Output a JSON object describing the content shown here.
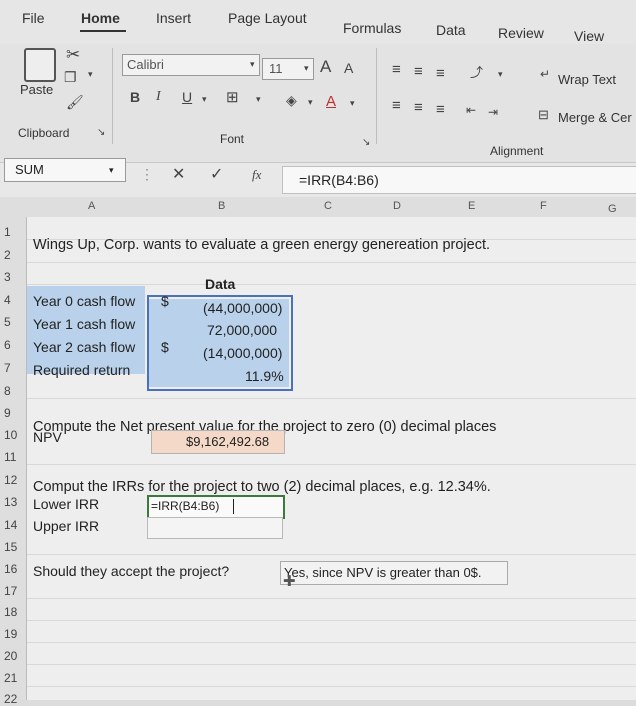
{
  "menu": {
    "file": "File",
    "home": "Home",
    "insert": "Insert",
    "page_layout": "Page Layout",
    "formulas": "Formulas",
    "data": "Data",
    "review": "Review",
    "view": "View"
  },
  "ribbon": {
    "paste": "Paste",
    "clipboard": "Clipboard",
    "font_name": "Calibri",
    "font_size": "11",
    "grow_font": "A",
    "shrink_font": "A",
    "bold": "B",
    "italic": "I",
    "underline": "U",
    "font_color": "A",
    "font_group": "Font",
    "wrap_text": "Wrap Text",
    "merge_center": "Merge & Cer",
    "alignment_group": "Alignment"
  },
  "formula_bar": {
    "name_box": "SUM",
    "cancel": "✕",
    "enter": "✓",
    "fx": "fx",
    "formula": "=IRR(B4:B6)"
  },
  "columns": [
    "A",
    "B",
    "C",
    "D",
    "E",
    "F",
    "G"
  ],
  "rows": [
    "1",
    "2",
    "3",
    "4",
    "5",
    "6",
    "7",
    "8",
    "9",
    "10",
    "11",
    "12",
    "13",
    "14",
    "15",
    "16",
    "17",
    "18",
    "19",
    "20",
    "21",
    "22"
  ],
  "cells": {
    "title": "Wings Up, Corp. wants to evaluate a green energy genereation project.",
    "data_header": "Data",
    "y0_label": "Year 0 cash flow",
    "y0_dollar": "$",
    "y0_value": "(44,000,000)",
    "y1_label": "Year 1 cash flow",
    "y1_value": "72,000,000",
    "y2_label": "Year 2 cash flow",
    "y2_dollar": "$",
    "y2_value": "(14,000,000)",
    "req_label": "Required return",
    "req_value": "11.9%",
    "npv_question": "Compute the Net present value for the project to zero (0) decimal places",
    "npv_label": "NPV",
    "npv_value": "$9,162,492.68",
    "irr_question": "Comput the IRRs for the project to two (2) decimal places, e.g. 12.34%.",
    "lower_irr_label": "Lower IRR",
    "lower_irr_formula": "=IRR(B4:B6)",
    "upper_irr_label": "Upper IRR",
    "accept_question": "Should they accept the project?",
    "accept_answer": "Yes, since NPV is greater than 0$."
  },
  "colors": {
    "input_fill": "#b9d1ea",
    "npv_fill": "#f4d9c8",
    "edit_border": "#3c7a3c"
  }
}
